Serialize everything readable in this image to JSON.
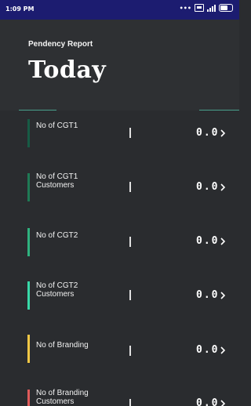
{
  "status_bar": {
    "time": "1:09 PM",
    "icons": [
      "more-dots-icon",
      "sim-icon",
      "signal-icon",
      "battery-icon"
    ]
  },
  "header": {
    "subtitle": "Pendency Report",
    "title": "Today"
  },
  "colors": {
    "background": "#2a2c2f",
    "status_bar": "#1c1c70",
    "divider": "#49a18c"
  },
  "rows": [
    {
      "label": "No of CGT1",
      "separator": "|",
      "value": "0.0",
      "accent": "#175b45",
      "icon": "chevron-right-icon"
    },
    {
      "label": "No of CGT1 Customers",
      "separator": "|",
      "value": "0.0",
      "accent": "#1f7a55",
      "icon": "chevron-right-icon"
    },
    {
      "label": "No of CGT2",
      "separator": "|",
      "value": "0.0",
      "accent": "#2fb27f",
      "icon": "chevron-right-icon"
    },
    {
      "label": "No of CGT2 Customers",
      "separator": "|",
      "value": "0.0",
      "accent": "#38d9a8",
      "icon": "chevron-right-icon"
    },
    {
      "label": "No of Branding",
      "separator": "|",
      "value": "0.0",
      "accent": "#f3c845",
      "icon": "chevron-right-icon"
    },
    {
      "label": "No of Branding Customers",
      "separator": "|",
      "value": "0.0",
      "accent": "#e05a5a",
      "icon": "chevron-right-icon"
    }
  ]
}
